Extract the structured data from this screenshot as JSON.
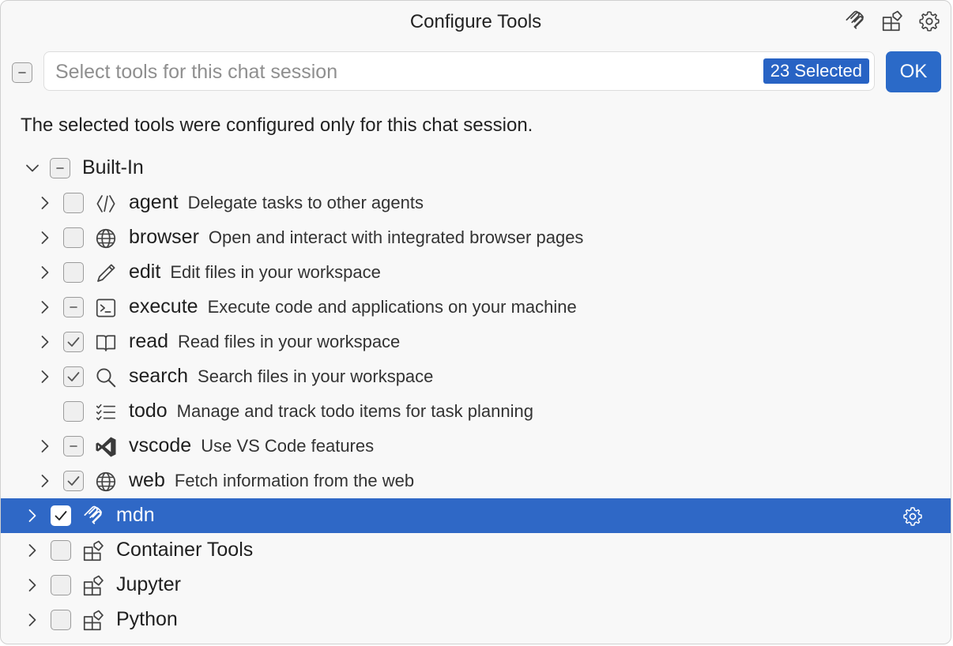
{
  "dialog": {
    "title": "Configure Tools",
    "actions": [
      {
        "name": "mcp-icon"
      },
      {
        "name": "extensions-icon"
      },
      {
        "name": "gear-icon"
      }
    ]
  },
  "input": {
    "placeholder": "Select tools for this chat session",
    "value": "",
    "selected_badge": "23 Selected",
    "ok_label": "OK",
    "select_all_state": "partial"
  },
  "notice": "The selected tools were configured only for this chat session.",
  "colors": {
    "accent": "#2b6ac8",
    "selection": "#2f68c6",
    "badge": "#2863c4"
  },
  "tree": {
    "builtin": {
      "label": "Built-In",
      "state": "partial",
      "expanded": true
    },
    "tools": [
      {
        "name": "agent",
        "desc": "Delegate tasks to other agents",
        "icon": "code-icon",
        "state": "unchecked",
        "expandable": true
      },
      {
        "name": "browser",
        "desc": "Open and interact with integrated browser pages",
        "icon": "globe-icon",
        "state": "unchecked",
        "expandable": true
      },
      {
        "name": "edit",
        "desc": "Edit files in your workspace",
        "icon": "pencil-icon",
        "state": "unchecked",
        "expandable": true
      },
      {
        "name": "execute",
        "desc": "Execute code and applications on your machine",
        "icon": "terminal-icon",
        "state": "partial",
        "expandable": true
      },
      {
        "name": "read",
        "desc": "Read files in your workspace",
        "icon": "book-icon",
        "state": "checked",
        "expandable": true
      },
      {
        "name": "search",
        "desc": "Search files in your workspace",
        "icon": "search-icon",
        "state": "checked",
        "expandable": true
      },
      {
        "name": "todo",
        "desc": "Manage and track todo items for task planning",
        "icon": "checklist-icon",
        "state": "unchecked",
        "expandable": false
      },
      {
        "name": "vscode",
        "desc": "Use VS Code features",
        "icon": "vscode-icon",
        "state": "partial",
        "expandable": true
      },
      {
        "name": "web",
        "desc": "Fetch information from the web",
        "icon": "globe-icon",
        "state": "checked",
        "expandable": true
      }
    ],
    "servers": [
      {
        "name": "mdn",
        "icon": "mcp-icon",
        "state": "checked",
        "selected": true,
        "has_gear": true
      },
      {
        "name": "Container Tools",
        "icon": "extensions-icon",
        "state": "unchecked",
        "selected": false
      },
      {
        "name": "Jupyter",
        "icon": "extensions-icon",
        "state": "unchecked",
        "selected": false
      },
      {
        "name": "Python",
        "icon": "extensions-icon",
        "state": "unchecked",
        "selected": false
      }
    ]
  }
}
